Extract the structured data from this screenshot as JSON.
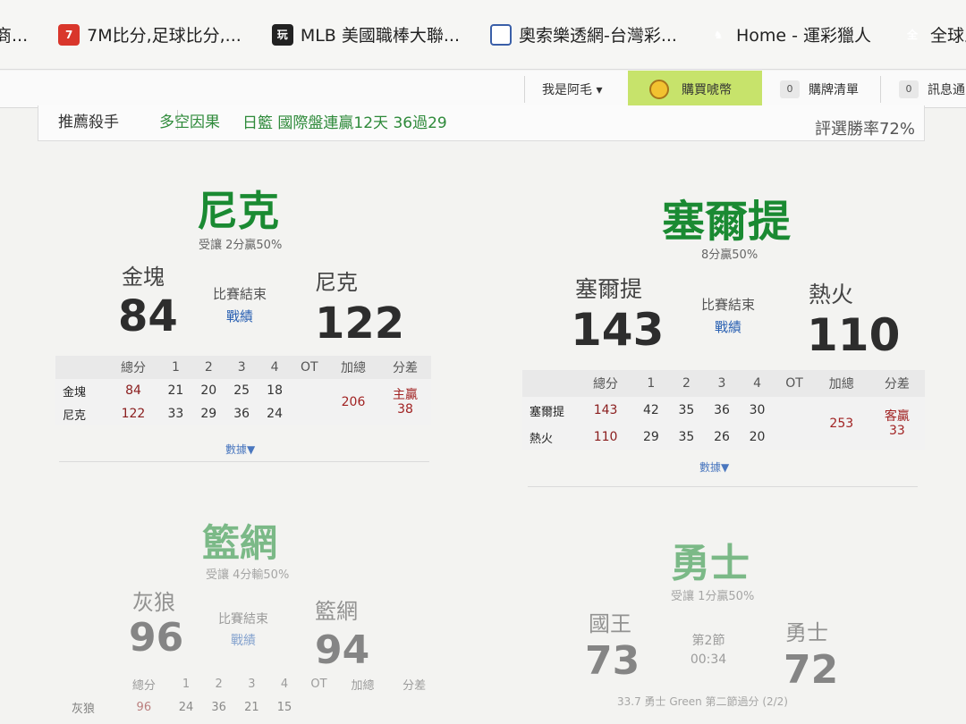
{
  "bookmarks": [
    {
      "label": "商...",
      "icon": "store-icon"
    },
    {
      "label": "7M比分,足球比分,...",
      "icon": "7m-logo-icon"
    },
    {
      "label": "MLB 美國職棒大聯...",
      "icon": "mlb-logo-icon"
    },
    {
      "label": "奧索樂透網-台灣彩...",
      "icon": "ao-logo-icon"
    },
    {
      "label": "Home - 運彩獵人",
      "icon": "hunter-logo-icon"
    },
    {
      "label": "全球即時",
      "icon": "globe-logo-icon"
    }
  ],
  "userbar": {
    "user": "我是阿毛 ▾",
    "buy": "購買唬幣",
    "cart_count": "0",
    "cart": "購牌清單",
    "msg_count": "0",
    "msg": "訊息通"
  },
  "recbar": {
    "title": "推薦殺手",
    "link": "多空因果",
    "pick": "日籃 國際盤連贏12天 36過29",
    "rate": "評選勝率72%"
  },
  "games": [
    {
      "winner": "尼克",
      "handicap": "受讓 2分贏50%",
      "away": "金塊",
      "away_score": "84",
      "home": "尼克",
      "home_score": "122",
      "status": "比賽結束",
      "record": "戰績",
      "headers": [
        "總分",
        "1",
        "2",
        "3",
        "4",
        "OT",
        "加總",
        "分差"
      ],
      "rows": [
        {
          "team": "金塊",
          "total": "84",
          "q": [
            "21",
            "20",
            "25",
            "18"
          ]
        },
        {
          "team": "尼克",
          "total": "122",
          "q": [
            "33",
            "29",
            "36",
            "24"
          ]
        }
      ],
      "sum": "206",
      "diff_label": "主贏",
      "diff": "38",
      "more": "數據▼"
    },
    {
      "winner": "塞爾提",
      "handicap": "8分贏50%",
      "away": "塞爾提",
      "away_score": "143",
      "home": "熱火",
      "home_score": "110",
      "status": "比賽結束",
      "record": "戰績",
      "headers": [
        "總分",
        "1",
        "2",
        "3",
        "4",
        "OT",
        "加總",
        "分差"
      ],
      "rows": [
        {
          "team": "塞爾提",
          "total": "143",
          "q": [
            "42",
            "35",
            "36",
            "30"
          ]
        },
        {
          "team": "熱火",
          "total": "110",
          "q": [
            "29",
            "35",
            "26",
            "20"
          ]
        }
      ],
      "sum": "253",
      "diff_label": "客贏",
      "diff": "33",
      "more": "數據▼"
    },
    {
      "winner": "籃網",
      "handicap": "受讓 4分輸50%",
      "away": "灰狼",
      "away_score": "96",
      "home": "籃網",
      "home_score": "94",
      "status": "比賽結束",
      "record": "戰績",
      "headers": [
        "總分",
        "1",
        "2",
        "3",
        "4",
        "OT",
        "加總",
        "分差"
      ],
      "rows": [
        {
          "team": "灰狼",
          "total": "96",
          "q": [
            "24",
            "36",
            "21",
            "15"
          ]
        }
      ]
    },
    {
      "winner": "勇士",
      "handicap": "受讓 1分贏50%",
      "away": "國王",
      "away_score": "73",
      "home": "勇士",
      "home_score": "72",
      "status": "第2節",
      "clock": "00:34",
      "note": "33.7 勇士 Green 第二節過分 (2/2)"
    }
  ]
}
